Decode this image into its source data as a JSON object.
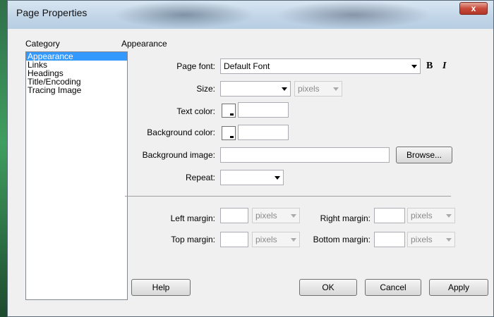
{
  "window": {
    "title": "Page Properties",
    "close_glyph": "x"
  },
  "category": {
    "header": "Category",
    "items": [
      "Appearance",
      "Links",
      "Headings",
      "Title/Encoding",
      "Tracing Image"
    ],
    "selected": "Appearance"
  },
  "section": {
    "title": "Appearance"
  },
  "fields": {
    "page_font": {
      "label": "Page font:",
      "value": "Default Font"
    },
    "size": {
      "label": "Size:",
      "value": "",
      "unit": "pixels"
    },
    "text_color": {
      "label": "Text color:",
      "value": ""
    },
    "bg_color": {
      "label": "Background color:",
      "value": ""
    },
    "bg_image": {
      "label": "Background image:",
      "value": ""
    },
    "repeat": {
      "label": "Repeat:",
      "value": ""
    }
  },
  "style_buttons": {
    "bold": "B",
    "italic": "I"
  },
  "margins": {
    "left": {
      "label": "Left margin:",
      "value": "",
      "unit": "pixels"
    },
    "right": {
      "label": "Right margin:",
      "value": "",
      "unit": "pixels"
    },
    "top": {
      "label": "Top margin:",
      "value": "",
      "unit": "pixels"
    },
    "bottom": {
      "label": "Bottom margin:",
      "value": "",
      "unit": "pixels"
    }
  },
  "buttons": {
    "browse": "Browse...",
    "help": "Help",
    "ok": "OK",
    "cancel": "Cancel",
    "apply": "Apply"
  },
  "colors": {
    "selection": "#3399ff",
    "titlebar": "#c3d6e8",
    "dialog_bg": "#f0f0f0"
  }
}
